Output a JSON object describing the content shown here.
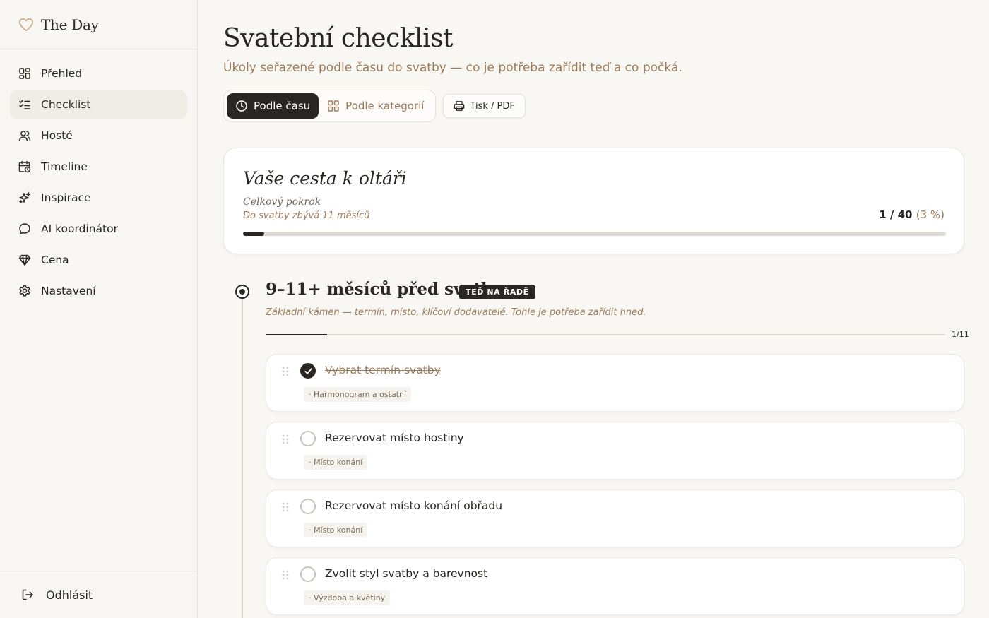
{
  "brand": {
    "name": "The Day",
    "icon": "heart-icon"
  },
  "sidebar": {
    "items": [
      {
        "label": "Přehled",
        "icon": "grid-icon",
        "active": false
      },
      {
        "label": "Checklist",
        "icon": "checklist-icon",
        "active": true
      },
      {
        "label": "Hosté",
        "icon": "users-icon",
        "active": false
      },
      {
        "label": "Timeline",
        "icon": "calendar-clock-icon",
        "active": false
      },
      {
        "label": "Inspirace",
        "icon": "sparkles-icon",
        "active": false
      },
      {
        "label": "AI koordinátor",
        "icon": "chat-bubble-icon",
        "active": false
      },
      {
        "label": "Cena",
        "icon": "diamond-icon",
        "active": false
      },
      {
        "label": "Nastavení",
        "icon": "gear-icon",
        "active": false
      }
    ],
    "logout_label": "Odhlásit"
  },
  "page": {
    "title": "Svatební checklist",
    "subtitle": "Úkoly seřazené podle času do svatby — co je potřeba zařídit teď a co počká."
  },
  "toolbar": {
    "view_time_label": "Podle času",
    "view_category_label": "Podle kategorií",
    "print_label": "Tisk / PDF",
    "active_view": "time"
  },
  "progress": {
    "title": "Vaše cesta k oltáři",
    "label": "Celkový pokrok",
    "remaining": "Do svatby zbývá 11 měsíců",
    "done": 1,
    "total": 40,
    "count_text": "1 / 40",
    "percent_text": "(3 %)",
    "fraction": 0.03
  },
  "phase": {
    "title": "9–11+ měsíců před svatbou",
    "badge": "TEĎ NA ŘADĚ",
    "description": "Základní kámen — termín, místo, klíčoví dodavatelé. Tohle je potřeba zařídit hned.",
    "count_text": "1/11",
    "fraction": 0.0909
  },
  "tasks": [
    {
      "title": "Vybrat termín svatby",
      "tag": "· Harmonogram a ostatní",
      "done": true
    },
    {
      "title": "Rezervovat místo hostiny",
      "tag": "· Místo konání",
      "done": false
    },
    {
      "title": "Rezervovat místo konání obřadu",
      "tag": "· Místo konání",
      "done": false
    },
    {
      "title": "Zvolit styl svatby a barevnost",
      "tag": "· Výzdoba a květiny",
      "done": false
    }
  ],
  "colors": {
    "accent": "#2a2623",
    "muted_brown": "#9b7b5a",
    "background": "#f9f7f3",
    "card": "#ffffff",
    "heart": "#c9a97e"
  }
}
